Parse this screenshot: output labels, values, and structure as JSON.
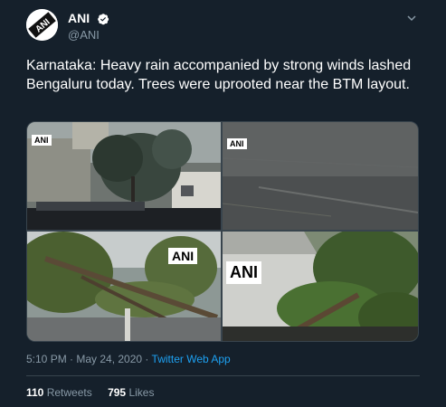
{
  "tweet": {
    "author": {
      "display_name": "ANI",
      "handle": "@ANI",
      "avatar_text": "ANI",
      "verified_icon": "verified-badge-icon"
    },
    "menu_icon": "chevron-down-icon",
    "text": "Karnataka: Heavy rain accompanied by strong winds lashed Bengaluru today. Trees were uprooted near the BTM layout.",
    "media": {
      "photos": [
        {
          "description": "trees swaying in rain near buildings",
          "watermark": "ANI"
        },
        {
          "description": "heavy rain falling on road",
          "watermark": "ANI"
        },
        {
          "description": "uprooted tree fallen across road",
          "watermark": "ANI"
        },
        {
          "description": "uprooted tree near building",
          "watermark": "ANI"
        }
      ]
    },
    "timestamp": "5:10 PM · May 24, 2020",
    "separator": " · ",
    "source_app": "Twitter Web App",
    "stats": {
      "retweets_count": "110",
      "retweets_label": "Retweets",
      "likes_count": "795",
      "likes_label": "Likes"
    },
    "colors": {
      "background": "#15202b",
      "secondary_text": "#8899a6",
      "link": "#1da1f2",
      "border": "#38444d"
    }
  }
}
